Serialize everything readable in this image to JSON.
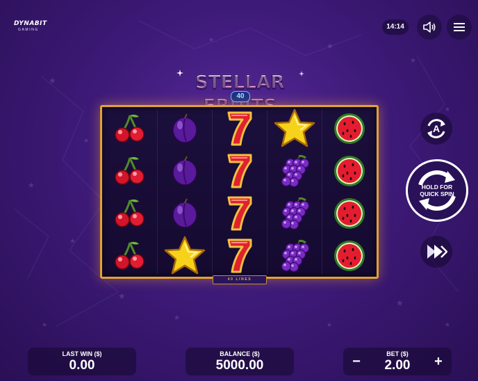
{
  "brand": {
    "name": "DYNABIT",
    "tagline": "GAMING"
  },
  "status": {
    "clock": "14:14"
  },
  "title": {
    "main": "STELLAR FRUITS",
    "sub": "40"
  },
  "reels": {
    "lines_label": "40 LINES",
    "grid": [
      [
        "cherry",
        "plum",
        "seven",
        "star",
        "watermelon"
      ],
      [
        "cherry",
        "plum",
        "seven",
        "grapes",
        "watermelon"
      ],
      [
        "cherry",
        "plum",
        "seven",
        "grapes",
        "watermelon"
      ],
      [
        "cherry",
        "star",
        "seven",
        "grapes",
        "watermelon"
      ]
    ]
  },
  "controls": {
    "autoplay_icon": "autoplay-icon",
    "spin_label_line1": "HOLD FOR",
    "spin_label_line2": "QUICK SPIN",
    "turbo_icon": "fast-forward-icon",
    "sound_icon": "speaker-icon",
    "menu_icon": "menu-icon"
  },
  "bottom": {
    "last_win_label": "LAST WIN ($)",
    "last_win_value": "0.00",
    "balance_label": "BALANCE ($)",
    "balance_value": "5000.00",
    "bet_label": "BET ($)",
    "bet_value": "2.00",
    "minus": "−",
    "plus": "+"
  },
  "colors": {
    "frame": "#e0a235",
    "background": "#3d1a78"
  }
}
